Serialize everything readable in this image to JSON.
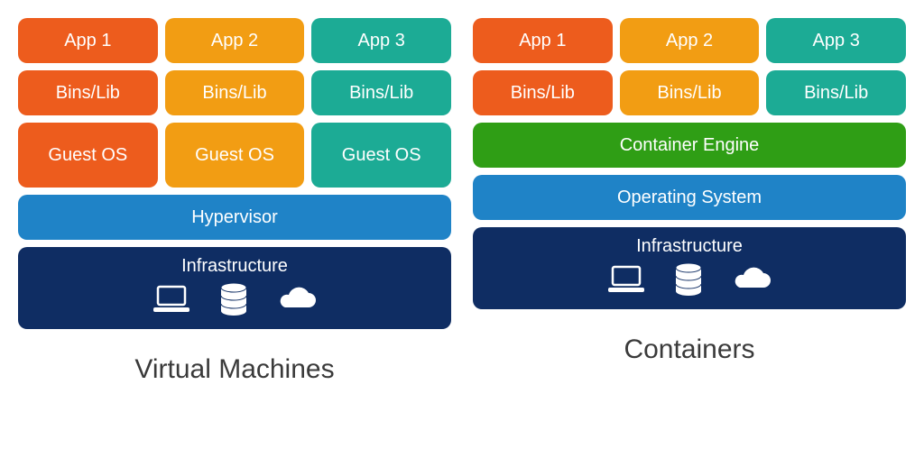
{
  "colors": {
    "orange": "#ed5c1d",
    "amber": "#f29d13",
    "teal": "#1cab95",
    "green": "#2f9e15",
    "blue": "#1f83c7",
    "navy": "#0f2d63"
  },
  "vm": {
    "caption": "Virtual Machines",
    "apps": [
      "App 1",
      "App 2",
      "App 3"
    ],
    "bins": [
      "Bins/Lib",
      "Bins/Lib",
      "Bins/Lib"
    ],
    "guest": [
      "Guest OS",
      "Guest OS",
      "Guest OS"
    ],
    "hypervisor": "Hypervisor",
    "infrastructure": "Infrastructure"
  },
  "ct": {
    "caption": "Containers",
    "apps": [
      "App 1",
      "App 2",
      "App 3"
    ],
    "bins": [
      "Bins/Lib",
      "Bins/Lib",
      "Bins/Lib"
    ],
    "engine": "Container Engine",
    "os": "Operating System",
    "infrastructure": "Infrastructure"
  }
}
